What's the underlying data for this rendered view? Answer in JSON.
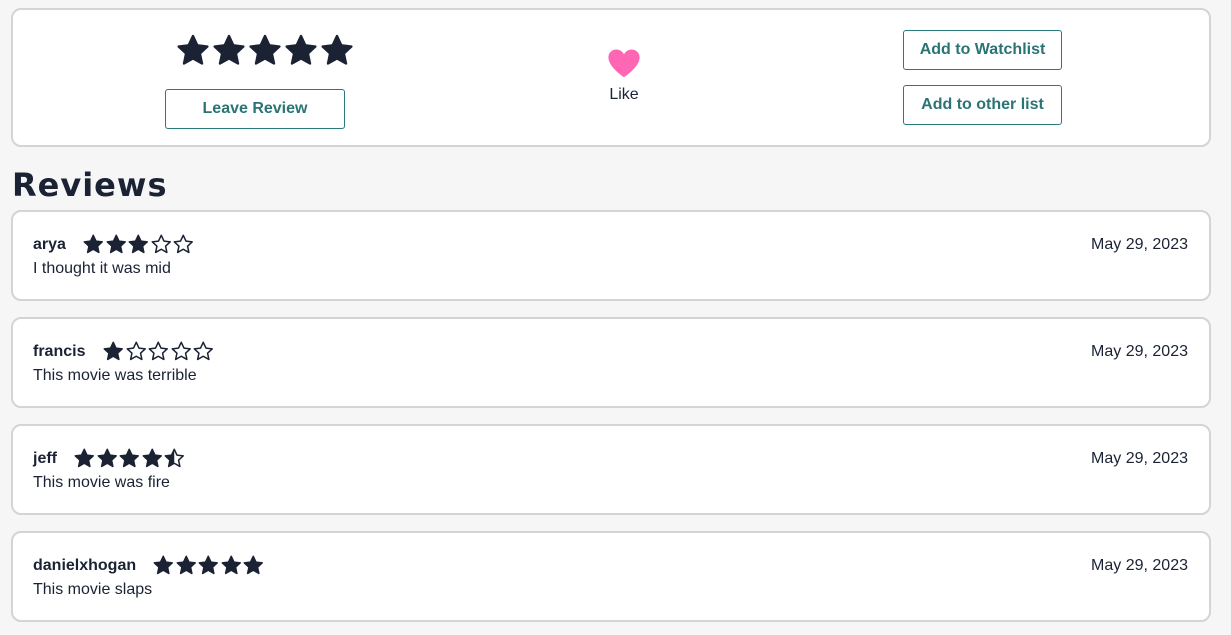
{
  "actions": {
    "overall_rating": 5,
    "leave_review_label": "Leave Review",
    "like_label": "Like",
    "watchlist_label": "Add to Watchlist",
    "other_list_label": "Add to other list",
    "like_color": "#ff66b3",
    "star_color": "#1a2233"
  },
  "reviews_heading": "Reviews",
  "reviews": [
    {
      "user": "arya",
      "rating": 3,
      "date": "May 29, 2023",
      "text": "I thought it was mid"
    },
    {
      "user": "francis",
      "rating": 1,
      "date": "May 29, 2023",
      "text": "This movie was terrible"
    },
    {
      "user": "jeff",
      "rating": 4.5,
      "date": "May 29, 2023",
      "text": "This movie was fire"
    },
    {
      "user": "danielxhogan",
      "rating": 5,
      "date": "May 29, 2023",
      "text": "This movie slaps"
    }
  ]
}
